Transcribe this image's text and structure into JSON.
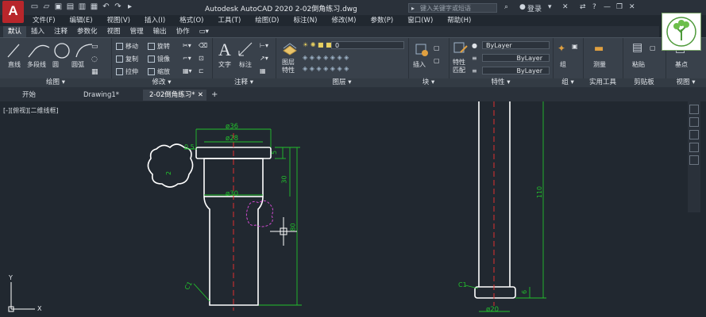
{
  "app": {
    "logo_letter": "A",
    "title": "Autodesk AutoCAD 2020    2-02倒角练习.dwg",
    "search_placeholder": "键入关键字或短语",
    "login": "登录",
    "brand_color": "#b8262b"
  },
  "quick_access": [
    "new-icon",
    "open-icon",
    "save-icon",
    "saveas-icon",
    "print-icon",
    "plot-icon",
    "undo-icon",
    "redo-icon",
    "share-icon"
  ],
  "menu": [
    "文件(F)",
    "编辑(E)",
    "视图(V)",
    "插入(I)",
    "格式(O)",
    "工具(T)",
    "绘图(D)",
    "标注(N)",
    "修改(M)",
    "参数(P)",
    "窗口(W)",
    "帮助(H)"
  ],
  "ribbon_tabs": [
    "默认",
    "插入",
    "注释",
    "参数化",
    "视图",
    "管理",
    "输出",
    "协作"
  ],
  "panels": {
    "draw": {
      "title": "绘图 ▾",
      "line": "直线",
      "polyline": "多段线",
      "circle": "圆",
      "arc": "圆弧"
    },
    "modify": {
      "title": "修改 ▾",
      "move": "移动",
      "rotate": "旋转",
      "copy": "复制",
      "mirror": "镜像",
      "stretch": "拉伸",
      "scale": "缩放"
    },
    "annotation": {
      "title": "注释 ▾",
      "text": "文字",
      "dimension": "标注"
    },
    "layers": {
      "title": "图层 ▾",
      "layer_props": "图层\n特性",
      "layer_props_1": "图层",
      "layer_props_2": "特性",
      "layer_value": "0"
    },
    "block": {
      "title": "块 ▾",
      "insert": "插入"
    },
    "properties": {
      "title": "特性 ▾",
      "match1": "特性",
      "match2": "匹配",
      "bylayer1": "ByLayer",
      "bylayer2": "ByLayer",
      "bylayer3": "ByLayer"
    },
    "groups": {
      "title": "组 ▾",
      "group": "组"
    },
    "utilities": {
      "title": "实用工具",
      "measure": "测量"
    },
    "clipboard": {
      "title": "剪贴板",
      "paste": "粘贴"
    },
    "view": {
      "title": "视图 ▾",
      "base": "基点"
    }
  },
  "doc_tabs": [
    {
      "label": "开始"
    },
    {
      "label": "Drawing1*"
    },
    {
      "label": "2-02倒角练习*"
    }
  ],
  "viewport_label": "[-][俯视][二维线框]",
  "dims": {
    "d36": "ø36",
    "d28": "ø28",
    "d30": "ø30",
    "d20": "ø20",
    "v05": "0.5",
    "v5": "5",
    "v30": "30",
    "v80": "80",
    "v110": "110",
    "v6": "6",
    "v2": "2",
    "c1a": "C1",
    "c1b": "C1"
  },
  "ucs": {
    "x": "X",
    "y": "Y"
  },
  "colors": {
    "dim": "#22c02c",
    "part": "#ffffff",
    "center": "#e03030",
    "highlight": "#d04ad0",
    "bg": "#212830"
  }
}
